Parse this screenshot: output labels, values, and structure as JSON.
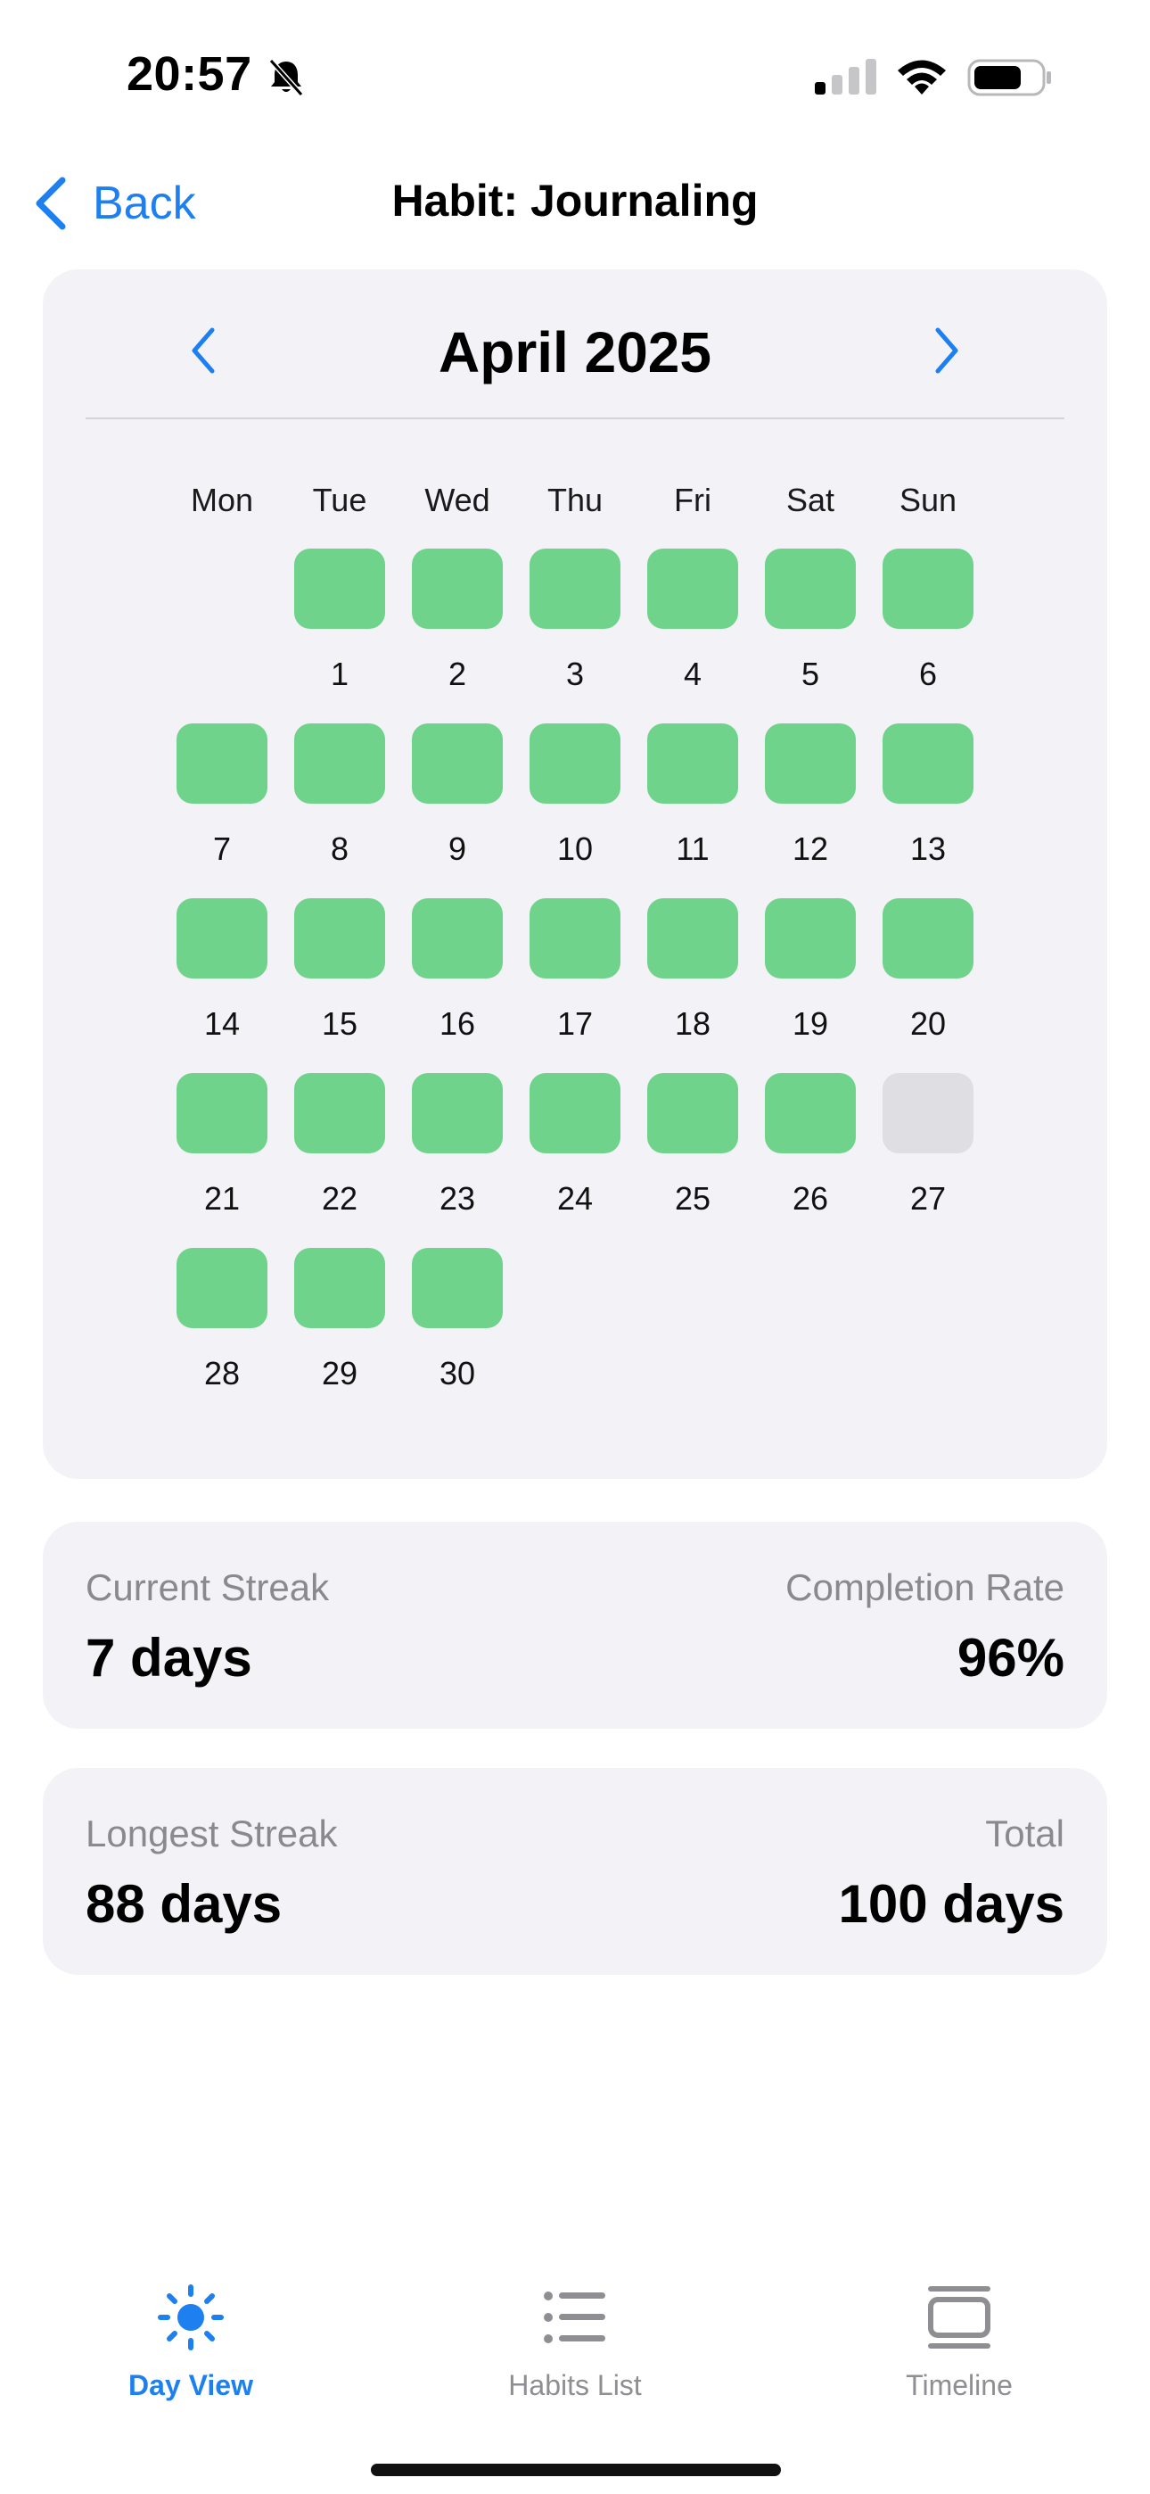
{
  "status_bar": {
    "time": "20:57",
    "icons": [
      "bell-slash-icon",
      "signal-icon",
      "wifi-icon",
      "battery-icon"
    ]
  },
  "nav": {
    "back_label": "Back",
    "title": "Habit: Journaling"
  },
  "calendar": {
    "month_label": "April 2025",
    "weekdays": [
      "Mon",
      "Tue",
      "Wed",
      "Thu",
      "Fri",
      "Sat",
      "Sun"
    ],
    "first_weekday_index": 1,
    "days": [
      {
        "n": "1",
        "done": true
      },
      {
        "n": "2",
        "done": true
      },
      {
        "n": "3",
        "done": true
      },
      {
        "n": "4",
        "done": true
      },
      {
        "n": "5",
        "done": true
      },
      {
        "n": "6",
        "done": true
      },
      {
        "n": "7",
        "done": true
      },
      {
        "n": "8",
        "done": true
      },
      {
        "n": "9",
        "done": true
      },
      {
        "n": "10",
        "done": true
      },
      {
        "n": "11",
        "done": true
      },
      {
        "n": "12",
        "done": true
      },
      {
        "n": "13",
        "done": true
      },
      {
        "n": "14",
        "done": true
      },
      {
        "n": "15",
        "done": true
      },
      {
        "n": "16",
        "done": true
      },
      {
        "n": "17",
        "done": true
      },
      {
        "n": "18",
        "done": true
      },
      {
        "n": "19",
        "done": true
      },
      {
        "n": "20",
        "done": true
      },
      {
        "n": "21",
        "done": true
      },
      {
        "n": "22",
        "done": true
      },
      {
        "n": "23",
        "done": true
      },
      {
        "n": "24",
        "done": true
      },
      {
        "n": "25",
        "done": true
      },
      {
        "n": "26",
        "done": true
      },
      {
        "n": "27",
        "done": false
      },
      {
        "n": "28",
        "done": true
      },
      {
        "n": "29",
        "done": true
      },
      {
        "n": "30",
        "done": true
      }
    ]
  },
  "stats": {
    "current_streak_label": "Current Streak",
    "current_streak_value": "7 days",
    "completion_rate_label": "Completion Rate",
    "completion_rate_value": "96%",
    "longest_streak_label": "Longest Streak",
    "longest_streak_value": "88 days",
    "total_label": "Total",
    "total_value": "100 days"
  },
  "tabs": [
    {
      "label": "Day View",
      "icon": "sun-icon",
      "active": true
    },
    {
      "label": "Habits List",
      "icon": "list-icon",
      "active": false
    },
    {
      "label": "Timeline",
      "icon": "timeline-icon",
      "active": false
    }
  ],
  "colors": {
    "accent": "#1e7ff0",
    "done": "#6fd38b",
    "missed": "#dedee3",
    "card": "#f2f2f7"
  }
}
